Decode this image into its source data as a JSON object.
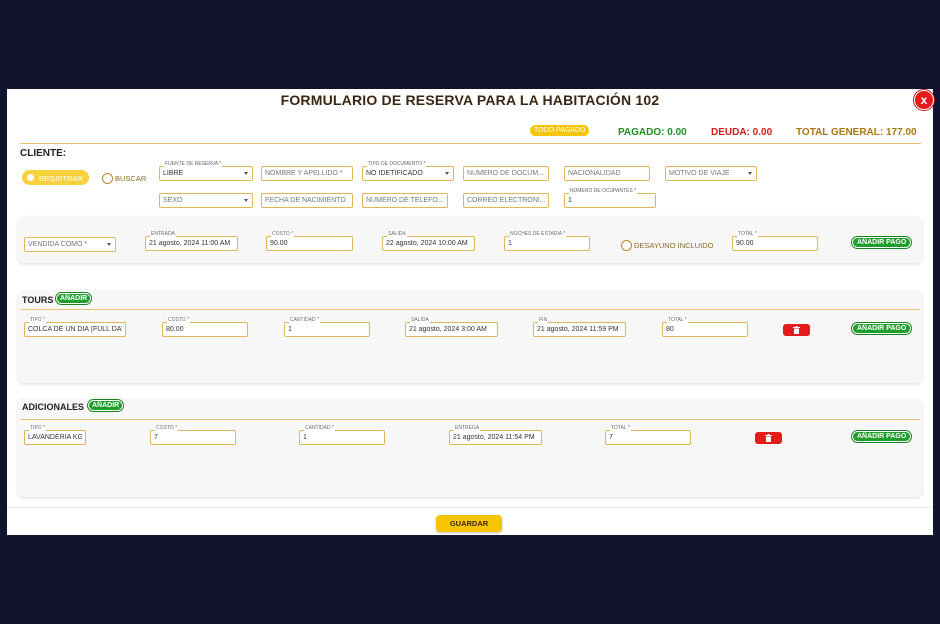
{
  "title": "FORMULARIO DE RESERVA PARA LA HABITACIÓN 102",
  "close_label": "x",
  "summary": {
    "paid_badge": "TODO PAGADO",
    "paid": "PAGADO: 0.00",
    "debt": "DEUDA: 0.00",
    "total": "TOTAL GENERAL: 177.00",
    "colors": {
      "paid": "#1e8f1e",
      "debt": "#d31919",
      "total": "#a9780f"
    }
  },
  "client": {
    "label": "CLIENTE:",
    "mode_register": "REGISTRAR",
    "mode_search": "BUSCAR",
    "fields": {
      "source_label": "FUENTE DE RESERVA *",
      "source_value": "LIBRE",
      "name_ph": "NOMBRE Y APELLIDO *",
      "doc_type_label": "TIPO DE DOCUMENTO *",
      "doc_type_value": "NO IDETIFICADO",
      "doc_number_ph": "NÚMERO DE DOCUM...",
      "nationality_ph": "NACIONALIDAD",
      "trip_reason_ph": "MOTIVO DE VIAJE",
      "sex_ph": "SEXO",
      "birth_ph": "FECHA DE NACIMIENTO",
      "phone_ph": "NÚMERO DE TELÉFO...",
      "email_ph": "CORREO ELECTRÓNI...",
      "occupants_label": "NÚMERO DE OCUPANTES *",
      "occupants_value": "1"
    }
  },
  "stay": {
    "sold_as_ph": "VENDIDA COMO *",
    "checkin_label": "ENTRADA",
    "checkin_value": "21 agosto, 2024 11:00 AM",
    "cost_label": "COSTO *",
    "cost_value": "90.00",
    "checkout_label": "SALIDA",
    "checkout_value": "22 agosto, 2024 10:00 AM",
    "nights_label": "NOCHES DE ESTADIA *",
    "nights_value": "1",
    "breakfast_label": "DESAYUNO INCLUIDO",
    "total_label": "TOTAL *",
    "total_value": "90.00",
    "pay_label": "AÑADIR PAGO"
  },
  "tours": {
    "title": "TOURS",
    "add_label": "AÑADIR",
    "row": {
      "type_label": "TIPO *",
      "type_value": "COLCA DE UN DIA (FULL DAY)",
      "cost_label": "COSTO *",
      "cost_value": "80.00",
      "qty_label": "CANTIDAD *",
      "qty_value": "1",
      "out_label": "SALIDA",
      "out_value": "21 agosto, 2024 3:00 AM",
      "end_label": "FIN",
      "end_value": "21 agosto, 2024 11:59 PM",
      "total_label": "TOTAL *",
      "total_value": "80",
      "pay_label": "AÑADIR PAGO"
    }
  },
  "extras": {
    "title": "ADICIONALES",
    "add_label": "AÑADIR",
    "row": {
      "type_label": "TIPO *",
      "type_value": "LAVANDERIA KG.",
      "cost_label": "COSTO *",
      "cost_value": "7",
      "qty_label": "CANTIDAD *",
      "qty_value": "1",
      "delivery_label": "ENTREGA",
      "delivery_value": "21 agosto, 2024 11:54 PM",
      "total_label": "TOTAL *",
      "total_value": "7",
      "pay_label": "AÑADIR PAGO"
    }
  },
  "save_label": "GUARDAR"
}
